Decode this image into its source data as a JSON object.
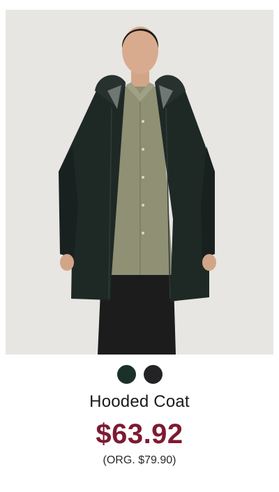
{
  "product": {
    "name": "Hooded Coat",
    "sale_price": "$63.92",
    "original_price": "(ORG. $79.90)"
  },
  "swatches": [
    {
      "color": "#1a312a"
    },
    {
      "color": "#232325"
    }
  ],
  "colors": {
    "sale_price": "#7d1a32",
    "image_background": "#e7e6e2"
  }
}
